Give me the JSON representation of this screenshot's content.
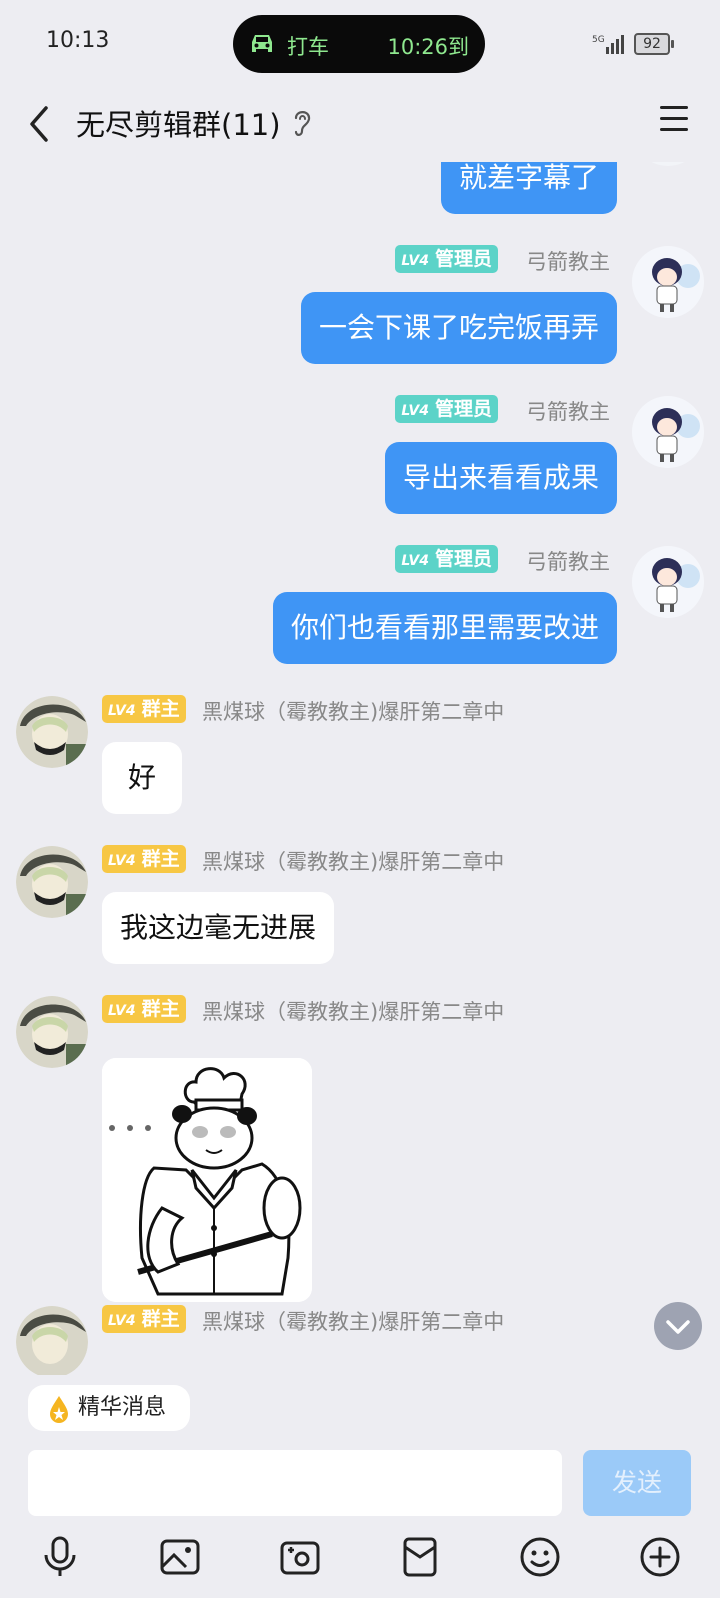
{
  "status": {
    "time": "10:13",
    "island_ride": "打车",
    "island_eta": "10:26到",
    "network": "5G",
    "battery": "92"
  },
  "header": {
    "title": "无尽剪辑群(11)"
  },
  "messages": [
    {
      "text": "就差字幕了"
    },
    {
      "badge_level": "LV4",
      "badge_role": "管理员",
      "sender": "弓箭教主",
      "text": "一会下课了吃完饭再弄"
    },
    {
      "badge_level": "LV4",
      "badge_role": "管理员",
      "sender": "弓箭教主",
      "text": "导出来看看成果"
    },
    {
      "badge_level": "LV4",
      "badge_role": "管理员",
      "sender": "弓箭教主",
      "text": "你们也看看那里需要改进"
    },
    {
      "badge_level": "LV4",
      "badge_role": "群主",
      "sender": "黑煤球（霉教教主)爆肝第二章中",
      "text": "好"
    },
    {
      "badge_level": "LV4",
      "badge_role": "群主",
      "sender": "黑煤球（霉教教主)爆肝第二章中",
      "text": "我这边毫无进展"
    },
    {
      "badge_level": "LV4",
      "badge_role": "群主",
      "sender": "黑煤球（霉教教主)爆肝第二章中"
    },
    {
      "badge_level": "LV4",
      "badge_role": "群主",
      "sender": "黑煤球（霉教教主)爆肝第二章中"
    }
  ],
  "bottom": {
    "essence_label": "精华消息",
    "input_value": "",
    "send_label": "发送"
  },
  "icons": [
    "car-icon",
    "back-arrow-icon",
    "ear-icon",
    "menu-icon",
    "chevron-down-icon",
    "essence-drop-icon",
    "microphone-icon",
    "image-icon",
    "camera-icon",
    "red-packet-icon",
    "emoji-icon",
    "plus-icon"
  ],
  "colors": {
    "my_bubble": "#3f95f5",
    "admin_badge": "#5cd3c8",
    "owner_badge": "#f7c744",
    "send_button": "#9bcaf8"
  }
}
